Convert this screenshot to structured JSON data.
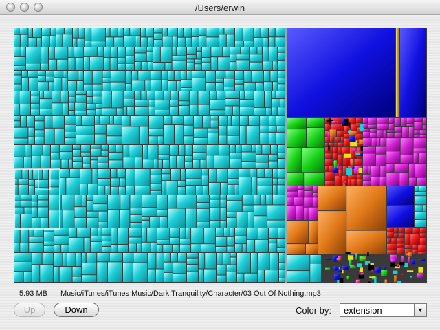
{
  "window": {
    "title": "/Users/erwin"
  },
  "status": {
    "size": "5.93 MB",
    "path": "Music/iTunes/iTunes Music/Dark Tranquility/Character/03 Out Of Nothing.mp3"
  },
  "buttons": {
    "up": "Up",
    "down": "Down"
  },
  "color_by": {
    "label": "Color by:",
    "selected": "extension",
    "arrow": "▼"
  },
  "treemap": {
    "colors": {
      "audio": "#1fd0d8",
      "blue": "#1010e0",
      "gold": "#c8a418",
      "green": "#18d018",
      "magenta": "#d020d0",
      "orange": "#e07818",
      "red": "#e01818",
      "yellow": "#e8e018",
      "selection": "#d8ffff"
    }
  }
}
